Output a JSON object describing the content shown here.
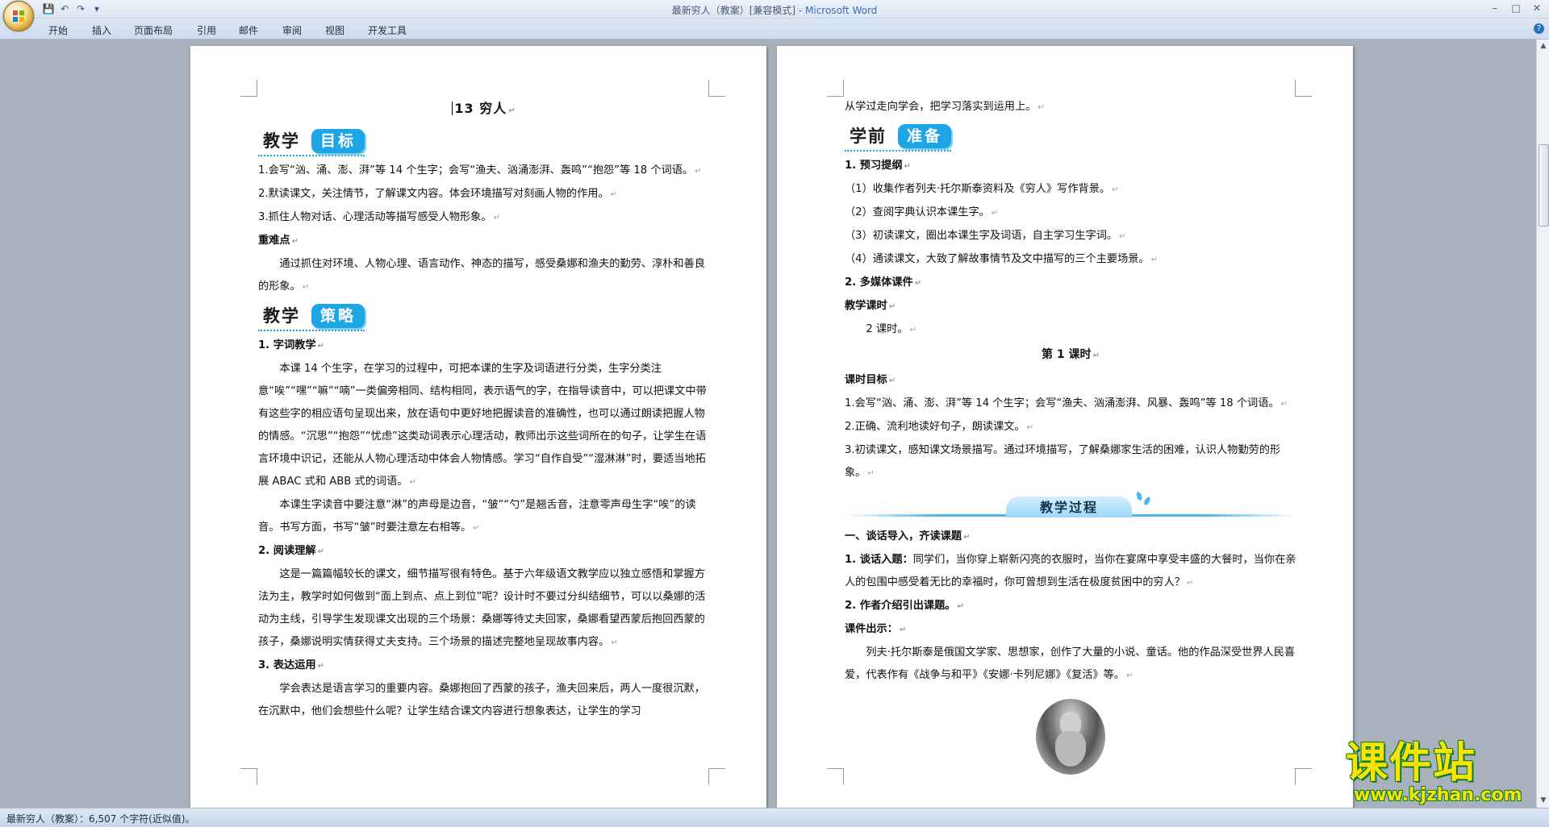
{
  "window": {
    "title_doc": "最新穷人（教案）[兼容模式] - ",
    "title_app": "Microsoft Word",
    "qat": {
      "save": "💾",
      "undo": "↶",
      "redo": "↷",
      "more": "▾"
    },
    "controls": {
      "minimize": "–",
      "maximize": "□",
      "close": "✕"
    }
  },
  "ribbon": {
    "tabs": [
      "开始",
      "插入",
      "页面布局",
      "引用",
      "邮件",
      "审阅",
      "视图",
      "开发工具"
    ],
    "help": "?"
  },
  "page1": {
    "title": "13  穷人",
    "heading_goal": {
      "left": "教学",
      "pill": "目标"
    },
    "goals": [
      "1.会写“汹、涌、澎、湃”等 14 个生字；会写“渔夫、汹涌澎湃、轰鸣”“抱怨”等 18 个词语。",
      "2.默读课文，关注情节，了解课文内容。体会环境描写对刻画人物的作用。",
      "3.抓住人物对话、心理活动等描写感受人物形象。"
    ],
    "key_title": "重难点",
    "key_text": "通过抓住对环境、人物心理、语言动作、神态的描写，感受桑娜和渔夫的勤劳、淳朴和善良的形象。",
    "heading_strategy": {
      "left": "教学",
      "pill": "策略"
    },
    "s1_title": "1. 字词教学",
    "s1_p1": "本课 14 个生字，在学习的过程中，可把本课的生字及词语进行分类，生字分类注意“唉”“嘿”“嘛”“喃”一类偏旁相同、结构相同，表示语气的字，在指导读音中，可以把课文中带有这些字的相应语句呈现出来，放在语句中更好地把握读音的准确性，也可以通过朗读把握人物的情感。“沉思”“抱怨”“忧虑”这类动词表示心理活动，教师出示这些词所在的句子，让学生在语言环境中识记，还能从人物心理活动中体会人物情感。学习“自作自受”“湿淋淋”时，要适当地拓展 ABAC 式和 ABB 式的词语。",
    "s1_p2": "本课生字读音中要注意“淋”的声母是边音，“皱”“勺”是翘舌音，注意零声母生字“唉”的读音。书写方面，书写“皱”时要注意左右相等。",
    "s2_title": "2. 阅读理解",
    "s2_p1": "这是一篇篇幅较长的课文，细节描写很有特色。基于六年级语文教学应以独立感悟和掌握方法为主，教学时如何做到“面上到点、点上到位”呢？设计时不要过分纠结细节，可以以桑娜的活动为主线，引导学生发现课文出现的三个场景：桑娜等待丈夫回家，桑娜看望西蒙后抱回西蒙的孩子，桑娜说明实情获得丈夫支持。三个场景的描述完整地呈现故事内容。",
    "s3_title": "3. 表达运用",
    "s3_p1": "学会表达是语言学习的重要内容。桑娜抱回了西蒙的孩子，渔夫回来后，两人一度很沉默，在沉默中，他们会想些什么呢？让学生结合课文内容进行想象表达，让学生的学习"
  },
  "page2": {
    "cont": "从学过走向学会，把学习落实到运用上。",
    "heading_prep": {
      "left": "学前",
      "pill": "准备"
    },
    "prep_title": "1. 预习提纲",
    "prep_items": [
      "（1）收集作者列夫·托尔斯泰资料及《穷人》写作背景。",
      "（2）查阅字典认识本课生字。",
      "（3）初读课文，圈出本课生字及词语，自主学习生字词。",
      "（4）通读课文，大致了解故事情节及文中描写的三个主要场景。"
    ],
    "media_title": "2. 多媒体课件",
    "hours_title": "教学课时",
    "hours_value": "2 课时。",
    "lesson_title": "第 1 课时",
    "lesson_goal_title": "课时目标",
    "lesson_goals": [
      "1.会写“汹、涌、澎、湃”等 14 个生字；会写“渔夫、汹涌澎湃、风暴、轰鸣”等 18 个词语。",
      "2.正确、流利地读好句子，朗读课文。",
      "3.初读课文，感知课文场景描写。通过环境描写，了解桑娜家生活的困难，认识人物勤劳的形象。"
    ],
    "process_banner": "教学过程",
    "part1_title": "一、谈话导入，齐读课题",
    "intro_label": "1. 谈话入题：",
    "intro_text": "同学们，当你穿上崭新闪亮的衣服时，当你在宴席中享受丰盛的大餐时，当你在亲人的包围中感受着无比的幸福时，你可曾想到生活在极度贫困中的穷人？",
    "author_title": "2. 作者介绍引出课题。",
    "courseware_title": "课件出示：",
    "author_text": "列夫·托尔斯泰是俄国文学家、思想家，创作了大量的小说、童话。他的作品深受世界人民喜爱，代表作有《战争与和平》《安娜·卡列尼娜》《复活》等。"
  },
  "statusbar": {
    "text": "最新穷人（教案）：6,507 个字符(近似值)。"
  },
  "watermark": {
    "big": "课件站",
    "url": "www.kjzhan.com"
  },
  "colors": {
    "accent": "#1ea5e6",
    "ribbon": "#dce6f4",
    "workspace": "#a9b1bd"
  },
  "return_mark": "↵"
}
